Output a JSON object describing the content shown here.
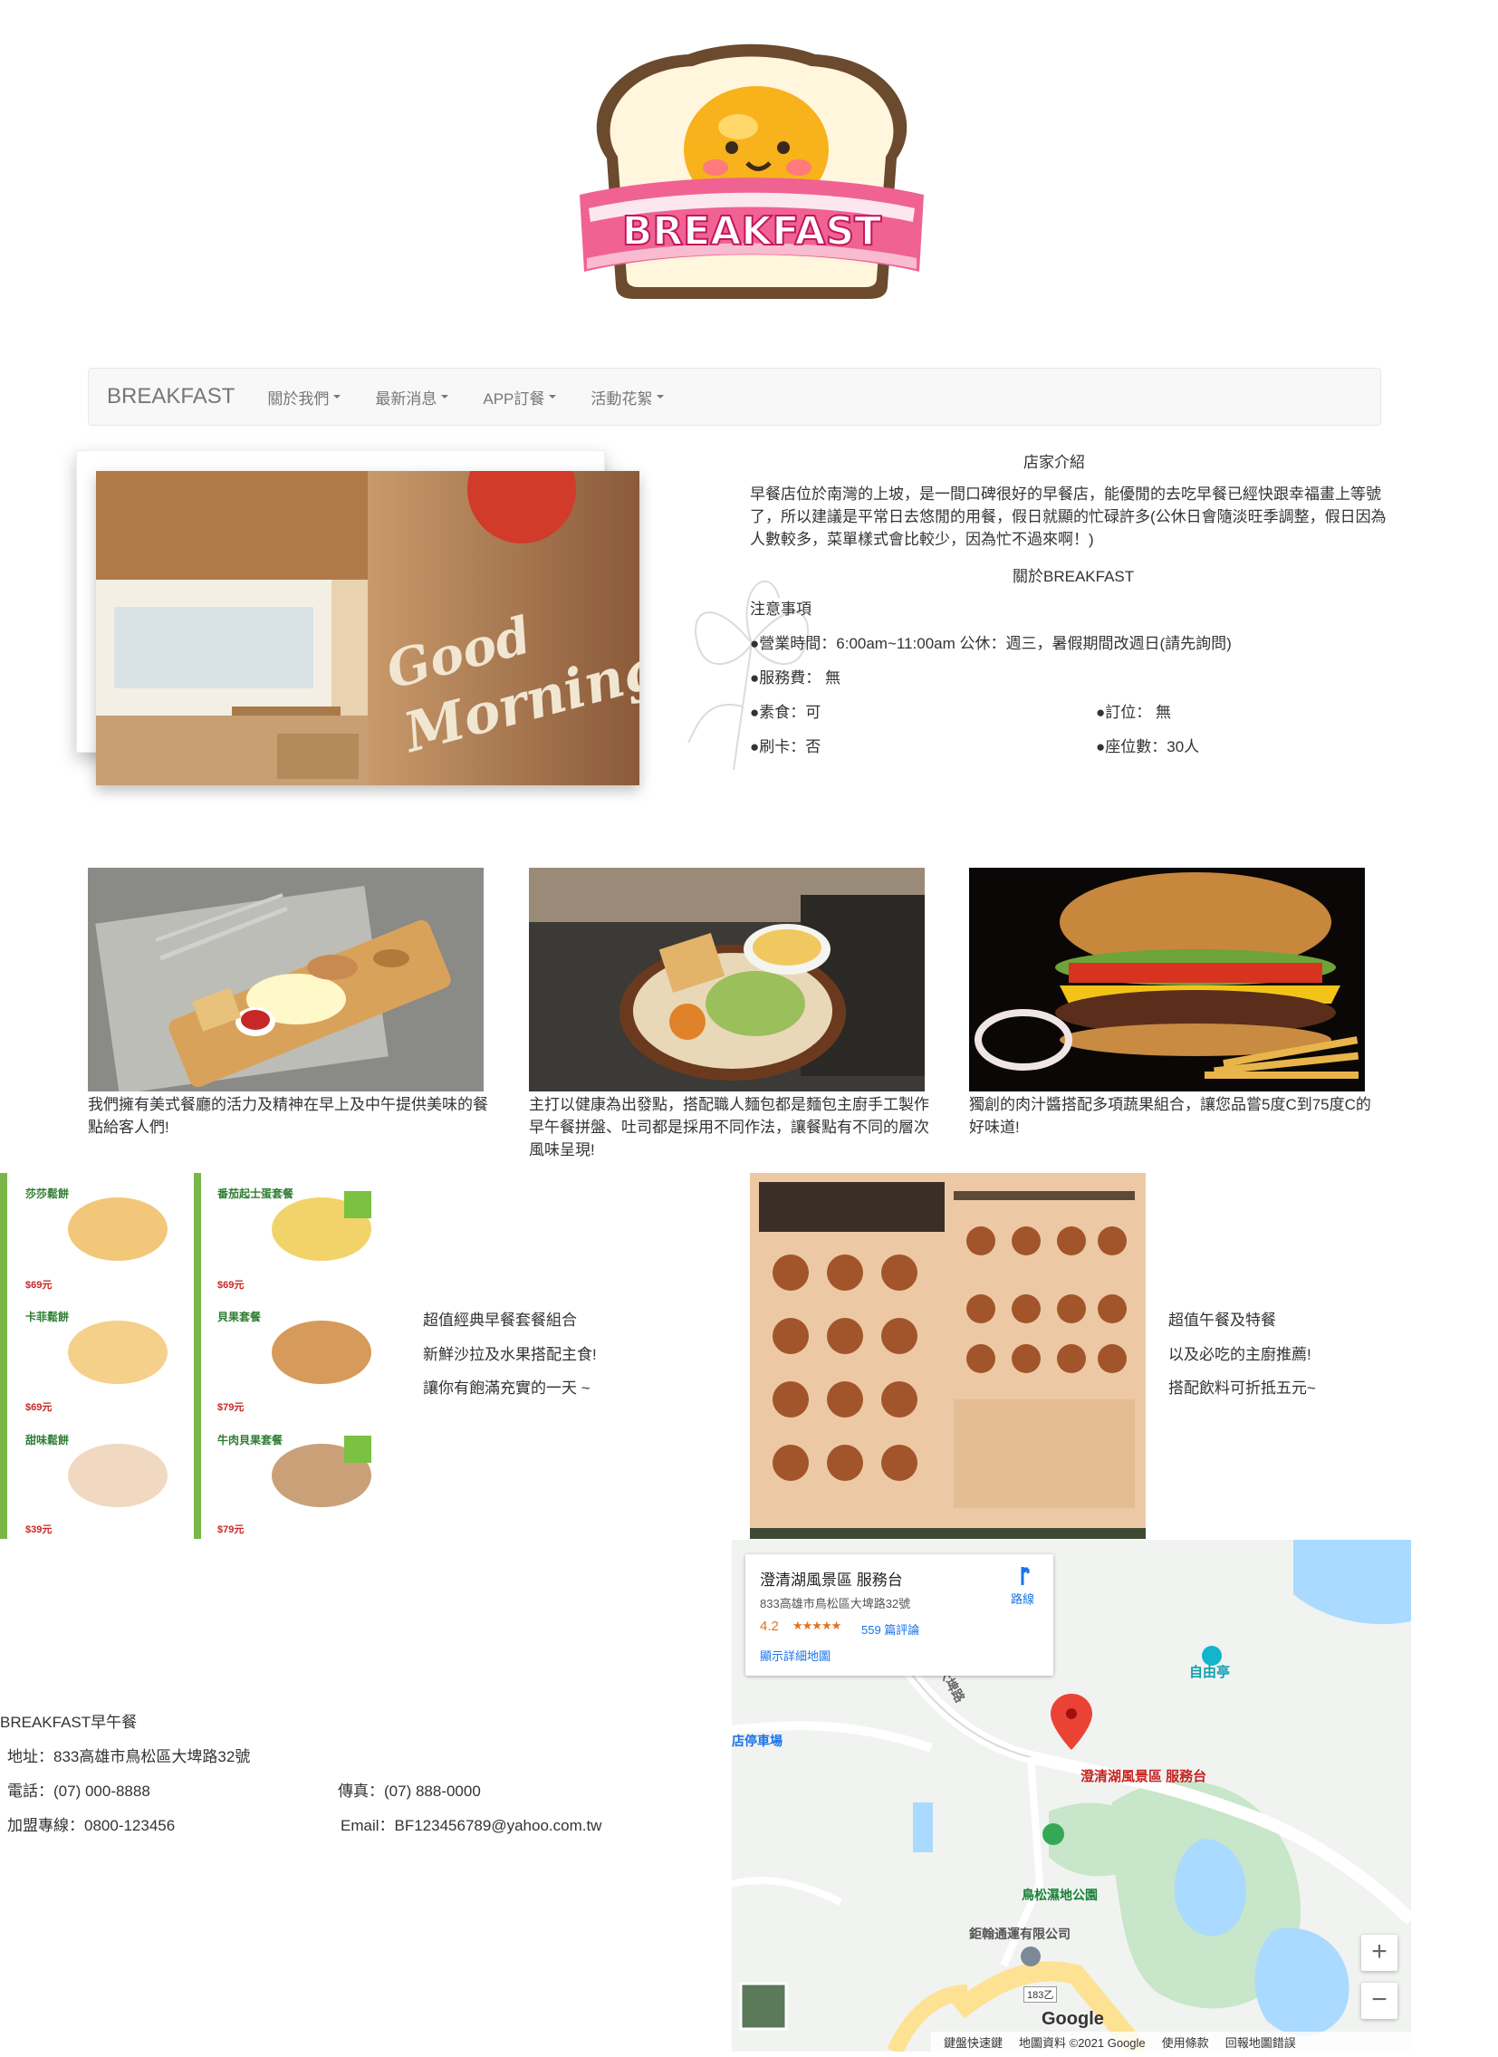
{
  "logo": {
    "text": "BREAKFAST"
  },
  "navbar": {
    "brand": "BREAKFAST",
    "items": [
      {
        "label": "關於我們"
      },
      {
        "label": "最新消息"
      },
      {
        "label": "APP訂餐"
      },
      {
        "label": "活動花絮"
      }
    ]
  },
  "intro": {
    "shop_intro_title": "店家介紹",
    "shop_intro_body": "早餐店位於南灣的上坡，是一間口碑很好的早餐店，能優閒的去吃早餐已經快跟幸福畫上等號了，所以建議是平常日去悠閒的用餐，假日就顯的忙碌許多(公休日會隨淡旺季調整，假日因為人數較多，菜單樣式會比較少，因為忙不過來啊！)",
    "about_title": "關於BREAKFAST",
    "notes_title": "注意事項",
    "hours": "●營業時間：6:00am~11:00am 公休：週三，暑假期間改週日(請先詢問)",
    "fee": "●服務費： 無",
    "veg": "●素食：可",
    "reserve": "●訂位： 無",
    "card": "●刷卡：否",
    "seats": "●座位數：30人"
  },
  "food": [
    {
      "caption": "我們擁有美式餐廳的活力及精神在早上及中午提供美味的餐點給客人們!"
    },
    {
      "caption": "主打以健康為出發點，搭配職人麵包都是麵包主廚手工製作 早午餐拼盤、吐司都是採用不同作法，讓餐點有不同的層次風味呈現!"
    },
    {
      "caption": "獨創的肉汁醬搭配多項蔬果組合，讓您品嘗5度C到75度C的好味道!"
    }
  ],
  "menu_left": {
    "lines": [
      "超值經典早餐套餐組合",
      "新鮮沙拉及水果搭配主食!",
      "讓你有飽滿充實的一天 ~"
    ],
    "items": [
      {
        "name": "莎莎鬆餅",
        "price": "$69元"
      },
      {
        "name": "番茄起士蛋套餐",
        "price": "$69元"
      },
      {
        "name": "卡菲鬆餅",
        "price": "$69元"
      },
      {
        "name": "貝果套餐",
        "price": "$79元"
      },
      {
        "name": "甜味鬆餅",
        "price": "$39元"
      },
      {
        "name": "牛肉貝果套餐",
        "price": "$79元"
      }
    ]
  },
  "menu_right": {
    "lines": [
      "超值午餐及特餐",
      "以及必吃的主廚推薦!",
      "搭配飲料可折抵五元~"
    ]
  },
  "footer": {
    "name": "BREAKFAST早午餐",
    "address": "地址：833高雄市鳥松區大埤路32號",
    "phone": "電話：(07) 000-8888",
    "fax": "傳真：(07) 888-0000",
    "franchise": "加盟專線：0800-123456",
    "email": "Email：BF123456789@yahoo.com.tw"
  },
  "map": {
    "place_name": "澄清湖風景區 服務台",
    "address": "833高雄市鳥松區大埤路32號",
    "rating": "4.2",
    "stars": "★★★★★",
    "reviews": "559 篇評論",
    "larger_map": "顯示詳細地圖",
    "directions": "路線",
    "labels": {
      "pin": "澄清湖風景區 服務台",
      "pavilion": "自由亭",
      "parking": "店停車場",
      "park": "鳥松濕地公園",
      "company": "鉅翰通運有限公司",
      "road": "大埤路",
      "route": "183乙"
    },
    "google": "Google",
    "footer_items": [
      "鍵盤快速鍵",
      "地圖資料 ©2021 Google",
      "使用條款",
      "回報地圖錯誤"
    ],
    "zoom_in": "+",
    "zoom_out": "−"
  },
  "colors": {
    "navbar_bg": "#f8f8f8",
    "accent_pink": "#f06292",
    "map_water": "#aadaff",
    "map_park": "#c8e6c9"
  }
}
